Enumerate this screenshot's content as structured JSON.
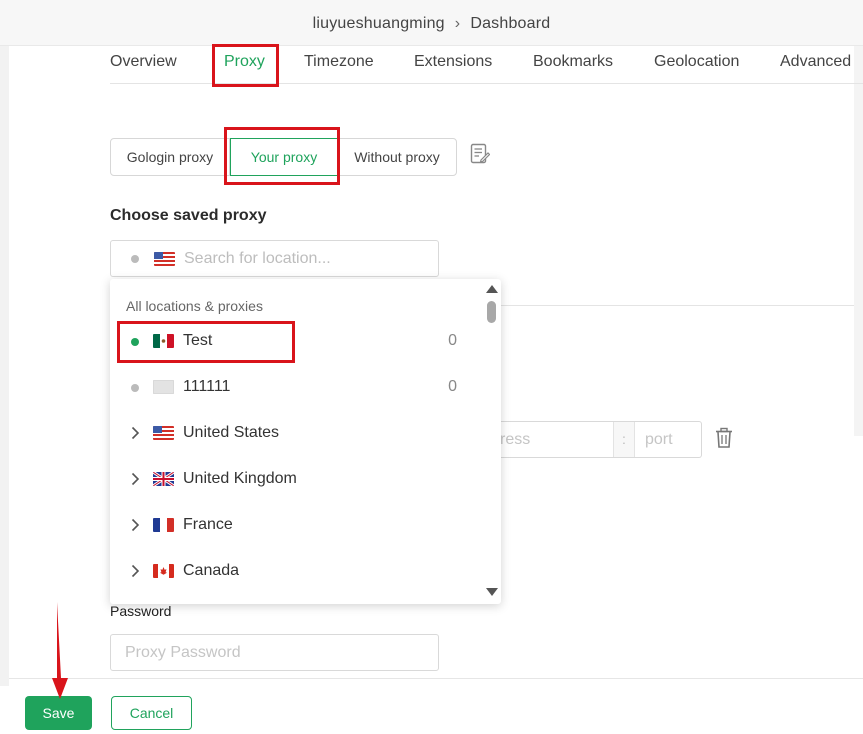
{
  "breadcrumb": {
    "profile": "liuyueshuangming",
    "separator": "›",
    "page": "Dashboard"
  },
  "tabs": [
    {
      "label": "Overview",
      "active": false
    },
    {
      "label": "Proxy",
      "active": true
    },
    {
      "label": "Timezone",
      "active": false
    },
    {
      "label": "Extensions",
      "active": false
    },
    {
      "label": "Bookmarks",
      "active": false
    },
    {
      "label": "Geolocation",
      "active": false
    },
    {
      "label": "Advanced",
      "active": false
    }
  ],
  "proxy_mode": {
    "options": [
      "Gologin proxy",
      "Your proxy",
      "Without proxy"
    ],
    "selected": "Your proxy",
    "notes_icon": "edit-note-icon"
  },
  "saved_proxy": {
    "title": "Choose saved proxy",
    "search_placeholder": "Search for location...",
    "search_flag": "us-flag"
  },
  "dropdown": {
    "header": "All locations & proxies",
    "items": [
      {
        "name": "Test",
        "count": "0",
        "flag": "mexico-flag",
        "status": "active",
        "type": "proxy"
      },
      {
        "name": "111111",
        "count": "0",
        "flag": "blank-flag",
        "status": "inactive",
        "type": "proxy"
      },
      {
        "name": "United States",
        "flag": "us-flag",
        "type": "location"
      },
      {
        "name": "United Kingdom",
        "flag": "uk-flag",
        "type": "location"
      },
      {
        "name": "France",
        "flag": "france-flag",
        "type": "location"
      },
      {
        "name": "Canada",
        "flag": "canada-flag",
        "type": "location"
      }
    ]
  },
  "proxy_host": {
    "address_placeholder": "ress",
    "colon": ":",
    "port_placeholder": "port"
  },
  "password": {
    "label": "Password",
    "placeholder": "Proxy Password"
  },
  "footer": {
    "save_label": "Save",
    "cancel_label": "Cancel"
  },
  "colors": {
    "accent": "#1fa35c",
    "highlight": "#d9141b",
    "active_dot": "#1fa35c",
    "inactive_dot": "#bbbbbb"
  }
}
